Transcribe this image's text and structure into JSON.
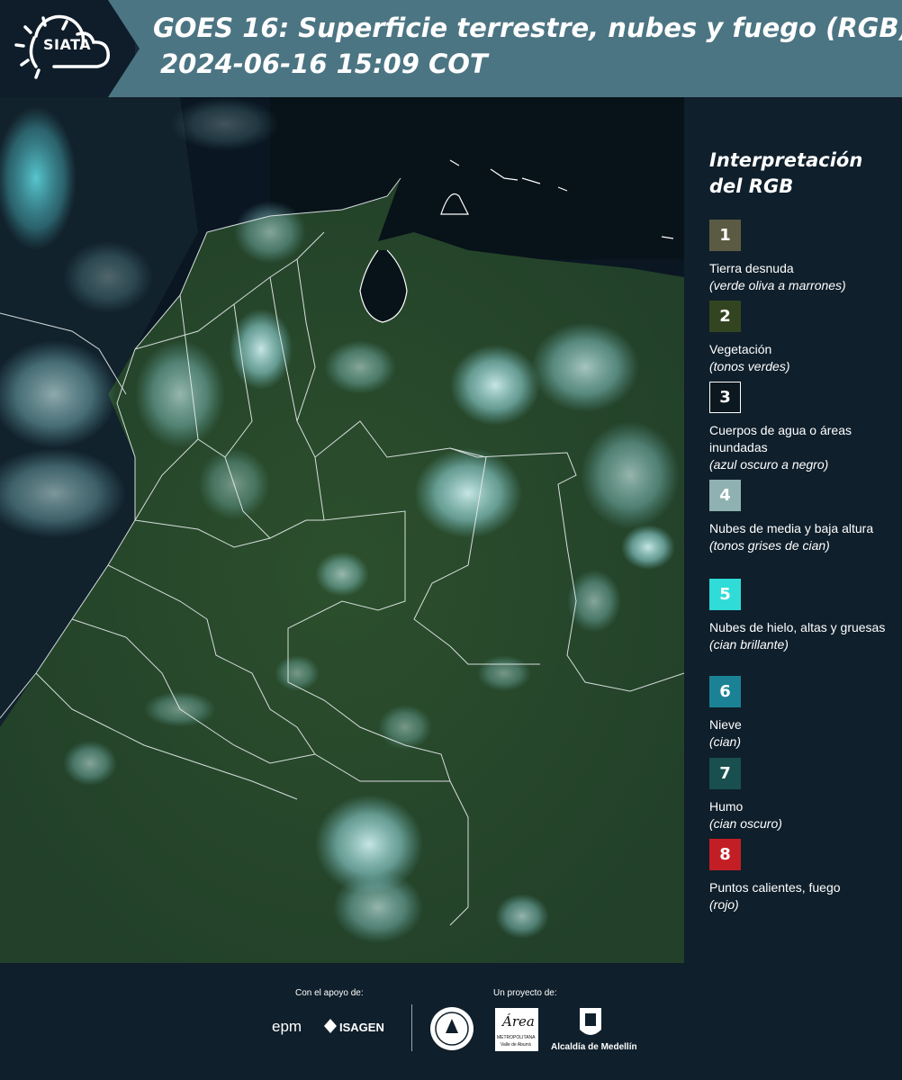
{
  "header": {
    "logo_text": "SIATA",
    "title_line1": "GOES 16: Superficie terrestre, nubes y fuego (RGB)",
    "title_line2": "2024-06-16 15:09 COT"
  },
  "legend": {
    "title_line1": "Interpretación",
    "title_line2": "del RGB",
    "items": [
      {
        "number": "1",
        "color": "#5b5b44",
        "label": "Tierra desnuda",
        "note": "(verde oliva a marrones)"
      },
      {
        "number": "2",
        "color": "#334520",
        "label": "Vegetación",
        "note": "(tonos verdes)"
      },
      {
        "number": "3",
        "color": "#0c1820",
        "label": "Cuerpos de agua o áreas inundadas",
        "note": "(azul oscuro a negro)"
      },
      {
        "number": "4",
        "color": "#8fb1b2",
        "label": "Nubes de media y baja altura",
        "note": "(tonos grises de cian)"
      },
      {
        "number": "5",
        "color": "#2fdcd7",
        "label": "Nubes de hielo, altas y gruesas",
        "note": "(cian brillante)"
      },
      {
        "number": "6",
        "color": "#1b8296",
        "label": "Nieve",
        "note": "(cian)"
      },
      {
        "number": "7",
        "color": "#194f4e",
        "label": "Humo",
        "note": "(cian oscuro)"
      },
      {
        "number": "8",
        "color": "#c41e25",
        "label": "Puntos calientes, fuego",
        "note": "(rojo)"
      }
    ]
  },
  "footer": {
    "support_caption": "Con el apoyo de:",
    "project_caption": "Un proyecto de:",
    "sponsor1": "epm",
    "sponsor2": "ISAGEN",
    "partner_area": "Área",
    "partner_area_sub": "METROPOLITANA",
    "partner_area_sub2": "Valle de Aburrá",
    "partner_alcaldia": "Alcaldía de Medellín"
  }
}
